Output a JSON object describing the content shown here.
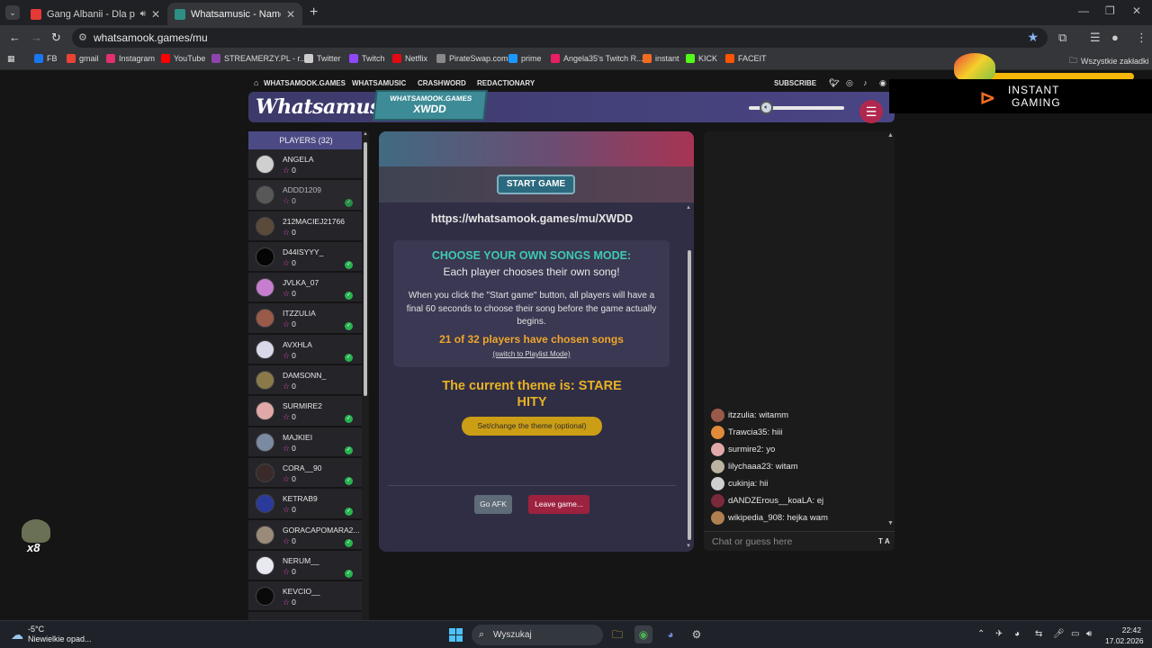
{
  "browser": {
    "tabs": [
      {
        "title": "Gang Albanii - Dla prawdziwych",
        "favicon_color": "#e53935"
      },
      {
        "title": "Whatsamusic - Name That Tune",
        "favicon_color": "#2d8f85"
      }
    ],
    "url": "whatsamook.games/mu",
    "bookmarks": [
      {
        "label": "FB",
        "color": "#1877f2"
      },
      {
        "label": "gmail",
        "color": "#ea4335"
      },
      {
        "label": "Instagram",
        "color": "#e1306c"
      },
      {
        "label": "YouTube",
        "color": "#ff0000"
      },
      {
        "label": "STREAMERZY.PL - r...",
        "color": "#8e44ad"
      },
      {
        "label": "Twitter",
        "color": "#cccccc"
      },
      {
        "label": "Twitch",
        "color": "#9146ff"
      },
      {
        "label": "Netflix",
        "color": "#e50914"
      },
      {
        "label": "PirateSwap.com",
        "color": "#888888"
      },
      {
        "label": "prime",
        "color": "#1a98ff"
      },
      {
        "label": "Angela35's Twitch R...",
        "color": "#e91e63"
      },
      {
        "label": "instant",
        "color": "#f26b21"
      },
      {
        "label": "KICK",
        "color": "#53fc18"
      },
      {
        "label": "FACEIT",
        "color": "#ff5500"
      }
    ],
    "all_bookmarks_label": "Wszystkie zakładki"
  },
  "site": {
    "nav": [
      "WHATSAMOOK.GAMES",
      "WHATSAMUSIC",
      "CRASHWORD",
      "REDACTIONARY"
    ],
    "subscribe": "SUBSCRIBE",
    "logo": "Whatsamusic",
    "room_badge_top": "WHATSAMOOK.GAMES",
    "room_code": "XWDD",
    "ad": {
      "line1": "INSTANT",
      "line2": "GAMING"
    }
  },
  "players": {
    "header": "PLAYERS (32)",
    "list": [
      {
        "name": "ANGELA",
        "score": "0",
        "ready": false,
        "avatar": "#cfcfcf",
        "dim": false
      },
      {
        "name": "ADDD1209",
        "score": "0",
        "ready": true,
        "avatar": "#6a6a6a",
        "dim": true
      },
      {
        "name": "212MACIEJ21766",
        "score": "0",
        "ready": false,
        "avatar": "#5a4a3a",
        "dim": false
      },
      {
        "name": "D44ISYYY_",
        "score": "0",
        "ready": true,
        "avatar": "#050505",
        "dim": false
      },
      {
        "name": "JVLKA_07",
        "score": "0",
        "ready": true,
        "avatar": "#c77dd0",
        "dim": false
      },
      {
        "name": "ITZZULIA",
        "score": "0",
        "ready": true,
        "avatar": "#9a5a4a",
        "dim": false
      },
      {
        "name": "AVXHLA",
        "score": "0",
        "ready": true,
        "avatar": "#d8d8e8",
        "dim": false
      },
      {
        "name": "DAMSONN_",
        "score": "0",
        "ready": false,
        "avatar": "#8a7a4a",
        "dim": false
      },
      {
        "name": "SURMIRE2",
        "score": "0",
        "ready": true,
        "avatar": "#e0a8a8",
        "dim": false
      },
      {
        "name": "MAJKIEI",
        "score": "0",
        "ready": true,
        "avatar": "#7a8aa0",
        "dim": false
      },
      {
        "name": "CORA__90",
        "score": "0",
        "ready": true,
        "avatar": "#3a2a2a",
        "dim": false
      },
      {
        "name": "KETRAB9",
        "score": "0",
        "ready": true,
        "avatar": "#2a3a9a",
        "dim": false
      },
      {
        "name": "GORACAPOMARA2...",
        "score": "0",
        "ready": true,
        "avatar": "#9a8a7a",
        "dim": false
      },
      {
        "name": "NERUM__",
        "score": "0",
        "ready": true,
        "avatar": "#e8e8f0",
        "dim": false
      },
      {
        "name": "KEVCIO__",
        "score": "0",
        "ready": false,
        "avatar": "#0a0a0a",
        "dim": false
      }
    ]
  },
  "game": {
    "start_label": "START GAME",
    "room_url": "https://whatsamook.games/mu/XWDD",
    "mode_title": "CHOOSE YOUR OWN SONGS MODE:",
    "mode_subtitle": "Each player chooses their own song!",
    "mode_desc": "When you click the \"Start game\" button, all players will have a final 60 seconds to choose their song before the game actually begins.",
    "chosen_status": "21 of 32 players have chosen songs",
    "switch_mode": "(switch to Playlist Mode)",
    "theme_line1": "The current theme is: STARE",
    "theme_line2": "HITY",
    "theme_button": "Set/change the theme (optional)",
    "afk_button": "Go AFK",
    "leave_button": "Leave game..."
  },
  "chat": {
    "messages": [
      {
        "text": "itzzulia: witamm",
        "avatar": "#9a5a4a"
      },
      {
        "text": "Trawcia35: hiii",
        "avatar": "#e08a3a"
      },
      {
        "text": "surmire2: yo",
        "avatar": "#e0a8a8"
      },
      {
        "text": "lilychaaa23: witam",
        "avatar": "#bbb3a0"
      },
      {
        "text": "cukinja: hii",
        "avatar": "#cfcfcf"
      },
      {
        "text": "dANDZErous__koaLA: ej",
        "avatar": "#7a2a3a"
      },
      {
        "text": "wikipedia_908: hejka wam",
        "avatar": "#b08050"
      }
    ],
    "placeholder": "Chat or guess here",
    "ta_label": "T A"
  },
  "afk_pet": {
    "count": "x8"
  },
  "taskbar": {
    "temp": "-5°C",
    "weather": "Niewielkie opad...",
    "search": "Wyszukaj",
    "time": "22:42",
    "date": "17.02.2026"
  }
}
